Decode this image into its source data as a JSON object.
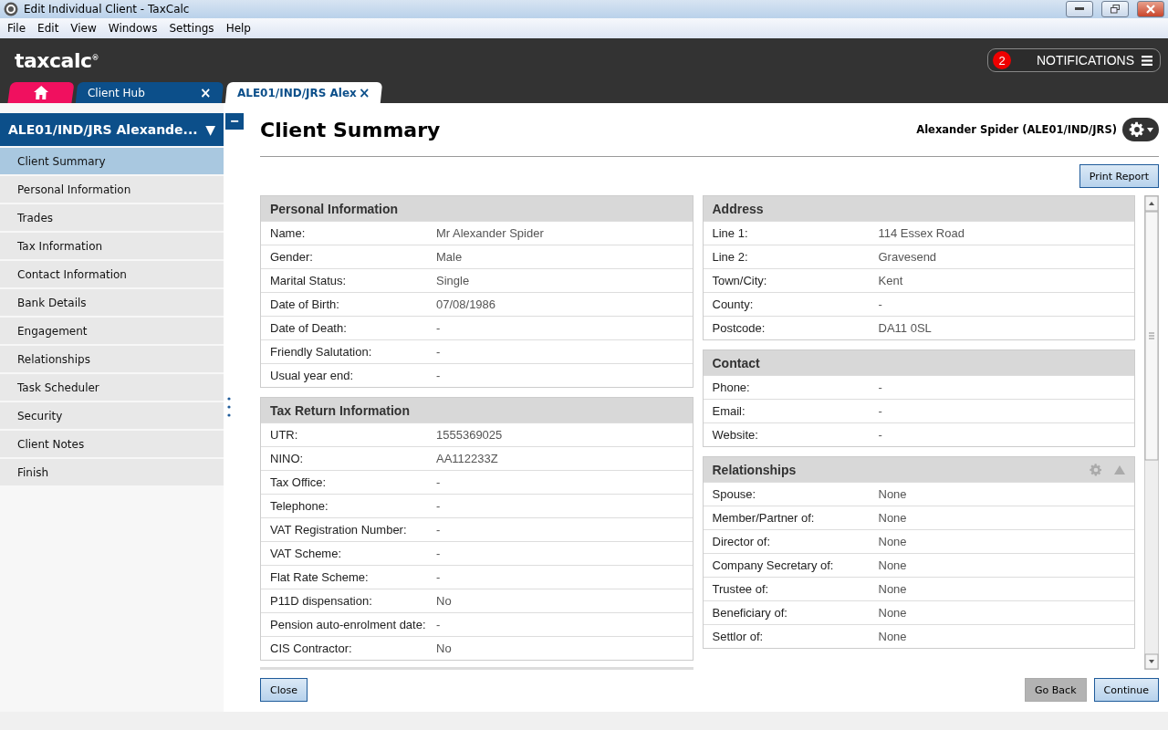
{
  "window": {
    "title": "Edit Individual Client - TaxCalc"
  },
  "menu": [
    "File",
    "Edit",
    "View",
    "Windows",
    "Settings",
    "Help"
  ],
  "header": {
    "logo": "taxcalc",
    "logo_mark": "®",
    "notifications": {
      "count": "2",
      "label": "NOTIFICATIONS"
    }
  },
  "tabs": [
    {
      "kind": "home",
      "selected": false
    },
    {
      "kind": "page",
      "label": "Client Hub",
      "selected": false,
      "close": "×"
    },
    {
      "kind": "page",
      "label": "ALE01/IND/JRS Alex",
      "selected": true,
      "close": "×"
    }
  ],
  "sidebar": {
    "title": "ALE01/IND/JRS Alexande...",
    "caret": "▼",
    "collapse": "−",
    "items": [
      {
        "label": "Client Summary",
        "selected": true
      },
      {
        "label": "Personal Information",
        "selected": false
      },
      {
        "label": "Trades",
        "selected": false
      },
      {
        "label": "Tax Information",
        "selected": false
      },
      {
        "label": "Contact Information",
        "selected": false
      },
      {
        "label": "Bank Details",
        "selected": false
      },
      {
        "label": "Engagement",
        "selected": false
      },
      {
        "label": "Relationships",
        "selected": false
      },
      {
        "label": "Task Scheduler",
        "selected": false
      },
      {
        "label": "Security",
        "selected": false
      },
      {
        "label": "Client Notes",
        "selected": false
      },
      {
        "label": "Finish",
        "selected": false
      }
    ]
  },
  "page": {
    "title": "Client Summary",
    "client": "Alexander Spider (ALE01/IND/JRS)",
    "print_button": "Print Report"
  },
  "columns": [
    [
      {
        "title": "Personal Information",
        "actions": false,
        "rows": [
          {
            "label": "Name:",
            "value": "Mr Alexander Spider"
          },
          {
            "label": "Gender:",
            "value": "Male"
          },
          {
            "label": "Marital Status:",
            "value": "Single"
          },
          {
            "label": "Date of Birth:",
            "value": "07/08/1986"
          },
          {
            "label": "Date of Death:",
            "value": "-"
          },
          {
            "label": "Friendly Salutation:",
            "value": "-"
          },
          {
            "label": "Usual year end:",
            "value": "-"
          }
        ]
      },
      {
        "title": "Tax Return Information",
        "actions": false,
        "rows": [
          {
            "label": "UTR:",
            "value": "1555369025"
          },
          {
            "label": "NINO:",
            "value": "AA112233Z"
          },
          {
            "label": "Tax Office:",
            "value": "-"
          },
          {
            "label": "Telephone:",
            "value": "-"
          },
          {
            "label": "VAT Registration Number:",
            "value": "-"
          },
          {
            "label": "VAT Scheme:",
            "value": "-"
          },
          {
            "label": "Flat Rate Scheme:",
            "value": "-"
          },
          {
            "label": "P11D dispensation:",
            "value": "No"
          },
          {
            "label": "Pension auto-enrolment date:",
            "value": "-"
          },
          {
            "label": "CIS Contractor:",
            "value": "No"
          }
        ]
      }
    ],
    [
      {
        "title": "Address",
        "actions": false,
        "rows": [
          {
            "label": "Line 1:",
            "value": "114 Essex Road"
          },
          {
            "label": "Line 2:",
            "value": "Gravesend"
          },
          {
            "label": "Town/City:",
            "value": "Kent"
          },
          {
            "label": "County:",
            "value": "-"
          },
          {
            "label": "Postcode:",
            "value": "DA11 0SL"
          }
        ]
      },
      {
        "title": "Contact",
        "actions": false,
        "rows": [
          {
            "label": "Phone:",
            "value": "-"
          },
          {
            "label": "Email:",
            "value": "-"
          },
          {
            "label": "Website:",
            "value": "-"
          }
        ]
      },
      {
        "title": "Relationships",
        "actions": true,
        "rows": [
          {
            "label": "Spouse:",
            "value": "None"
          },
          {
            "label": "Member/Partner of:",
            "value": "None"
          },
          {
            "label": "Director of:",
            "value": "None"
          },
          {
            "label": "Company Secretary of:",
            "value": "None"
          },
          {
            "label": "Trustee of:",
            "value": "None"
          },
          {
            "label": "Beneficiary of:",
            "value": "None"
          },
          {
            "label": "Settlor of:",
            "value": "None"
          }
        ]
      }
    ]
  ],
  "footer": {
    "close": "Close",
    "back": "Go Back",
    "continue": "Continue"
  }
}
